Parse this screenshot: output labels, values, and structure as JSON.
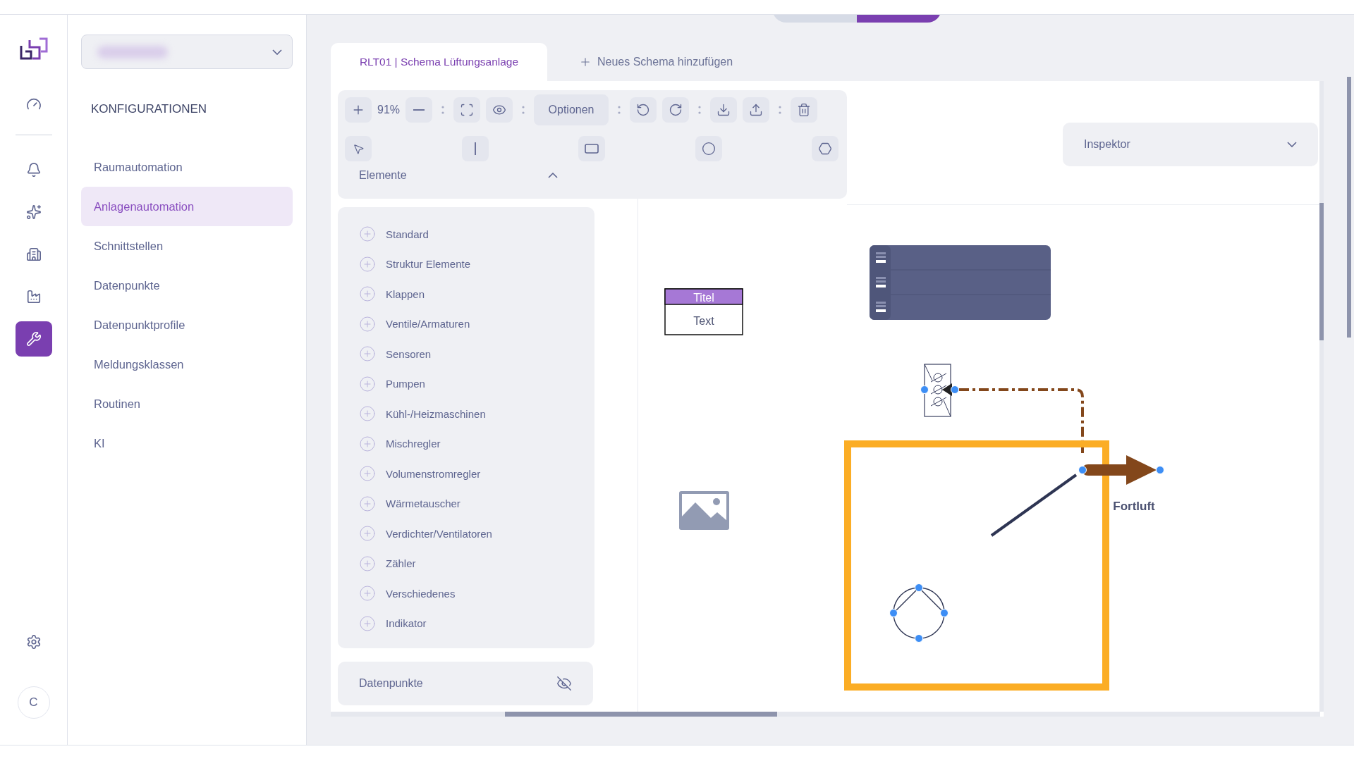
{
  "rail": {
    "items": [
      {
        "kind": "dashboard",
        "selected": false
      },
      {
        "kind": "bell",
        "selected": false
      },
      {
        "kind": "sparkles",
        "selected": false
      },
      {
        "kind": "building",
        "selected": false
      },
      {
        "kind": "plant",
        "selected": false
      },
      {
        "kind": "wrench",
        "selected": true
      }
    ],
    "avatar": "C"
  },
  "nav": {
    "heading": "KONFIGURATIONEN",
    "items": [
      {
        "label": "Raumautomation",
        "selected": false
      },
      {
        "label": "Anlagenautomation",
        "selected": true
      },
      {
        "label": "Schnittstellen",
        "selected": false
      },
      {
        "label": "Datenpunkte",
        "selected": false
      },
      {
        "label": "Datenpunktprofile",
        "selected": false
      },
      {
        "label": "Meldungsklassen",
        "selected": false
      },
      {
        "label": "Routinen",
        "selected": false
      },
      {
        "label": "KI",
        "selected": false
      }
    ]
  },
  "tabs": [
    {
      "label": "RLT01 | Schema Lüftungsanlage",
      "selected": true
    }
  ],
  "add_tab": "Neues Schema hinzufügen",
  "toolbar": {
    "zoom": "91%",
    "options_button": "Optionen"
  },
  "elements": {
    "title": "Elemente",
    "expanded": true,
    "categories": [
      "Standard",
      "Struktur Elemente",
      "Klappen",
      "Ventile/Armaturen",
      "Sensoren",
      "Pumpen",
      "Kühl-/Heizmaschinen",
      "Mischregler",
      "Volumenstromregler",
      "Wärmetauscher",
      "Verdichter/Ventilatoren",
      "Zähler",
      "Verschiedenes",
      "Indikator"
    ]
  },
  "datapoints": {
    "title": "Datenpunkte",
    "visible": false
  },
  "inspector": {
    "title": "Inspektor",
    "expanded": false
  },
  "canvas": {
    "table_node": {
      "title": "Titel",
      "text": "Text"
    },
    "arrow_label": "Fortluft"
  }
}
